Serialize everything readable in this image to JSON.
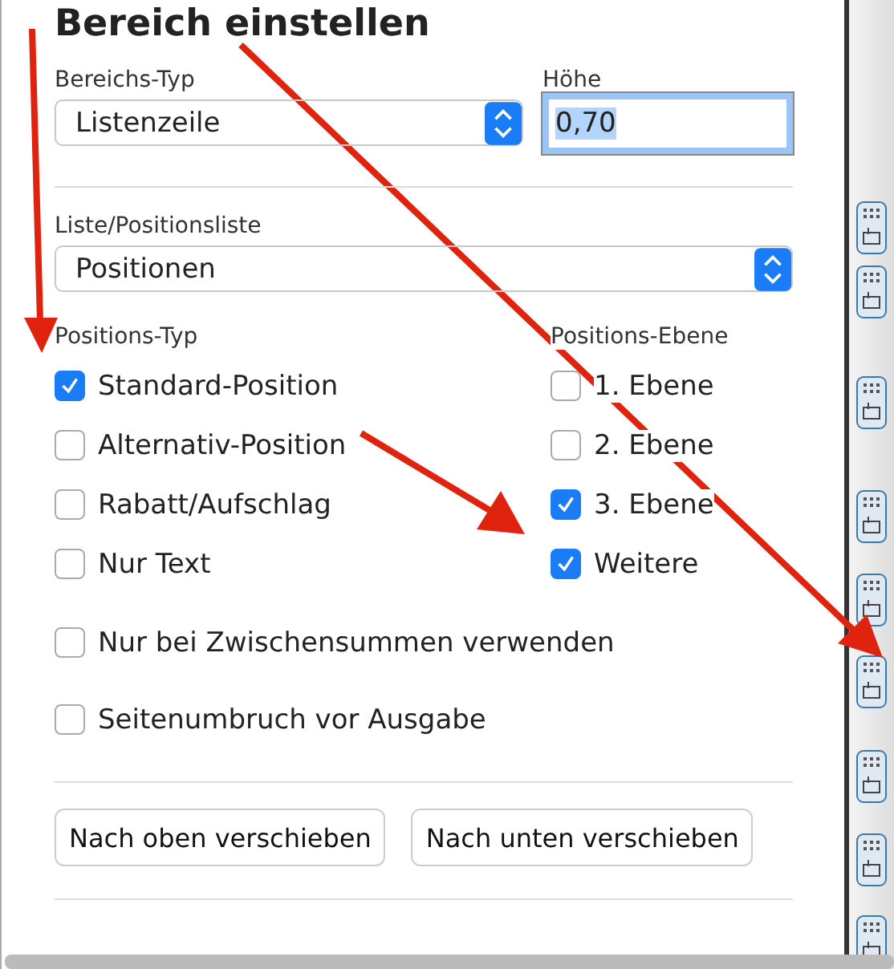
{
  "title": "Bereich einstellen",
  "area_type": {
    "label": "Bereichs-Typ",
    "value": "Listenzeile"
  },
  "height": {
    "label": "Höhe",
    "value": "0,70"
  },
  "list": {
    "label": "Liste/Positionsliste",
    "value": "Positionen"
  },
  "position_type": {
    "label": "Positions-Typ",
    "options": [
      {
        "label": "Standard-Position",
        "checked": true
      },
      {
        "label": "Alternativ-Position",
        "checked": false
      },
      {
        "label": "Rabatt/Aufschlag",
        "checked": false
      },
      {
        "label": "Nur Text",
        "checked": false
      }
    ]
  },
  "position_level": {
    "label": "Positions-Ebene",
    "options": [
      {
        "label": "1. Ebene",
        "checked": false
      },
      {
        "label": "2. Ebene",
        "checked": false
      },
      {
        "label": "3. Ebene",
        "checked": true
      },
      {
        "label": "Weitere",
        "checked": true
      }
    ]
  },
  "options": [
    {
      "label": "Nur bei Zwischensummen verwenden",
      "checked": false
    },
    {
      "label": "Seitenumbruch vor Ausgabe",
      "checked": false
    }
  ],
  "buttons": [
    "Nach oben verschieben",
    "Nach unten verschieben"
  ]
}
